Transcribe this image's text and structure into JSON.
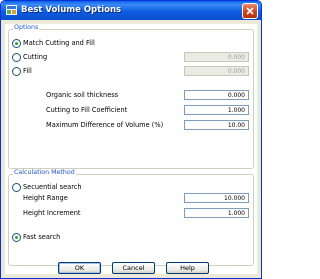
{
  "window": {
    "title": "Best Volume Options"
  },
  "options": {
    "group_title": "Options",
    "match_label": "Match Cutting and Fill",
    "cutting_label": "Cutting",
    "cutting_value": "0.000",
    "fill_label": "Fill",
    "fill_value": "0.000",
    "organic_label": "Organic soil thickness",
    "organic_value": "0.000",
    "coeff_label": "Cutting to Fill Coefficient",
    "coeff_value": "1.000",
    "maxdiff_label": "Maximum Difference of Volume (%)",
    "maxdiff_value": "10.00",
    "selected": "match"
  },
  "calc": {
    "group_title": "Calculation Method",
    "sequential_label": "Secuential search",
    "height_range_label": "Height Range",
    "height_range_value": "10.000",
    "height_inc_label": "Height Increment",
    "height_inc_value": "1.000",
    "fast_label": "Fast search",
    "selected": "fast"
  },
  "buttons": {
    "ok": "OK",
    "cancel": "Cancel",
    "help": "Help"
  },
  "colors": {
    "titlebar": "#0a5fe8",
    "group_title": "#1b55d4",
    "radio_dot": "#2fa82f",
    "close": "#c8411b"
  }
}
